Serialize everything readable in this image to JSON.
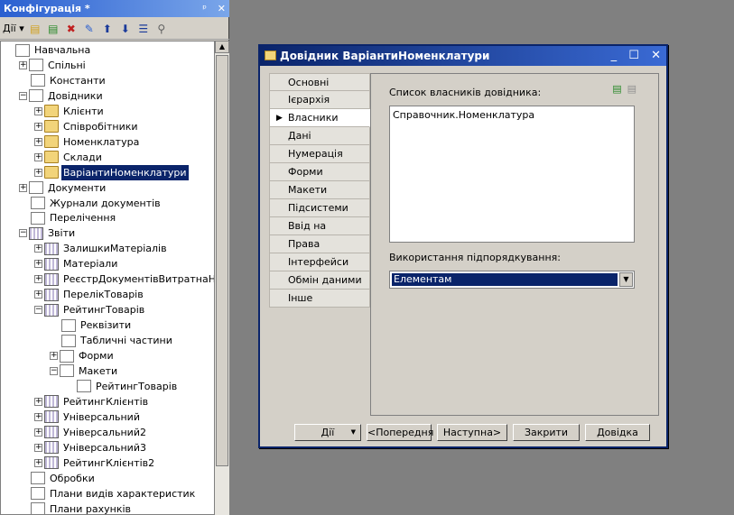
{
  "config_panel": {
    "title": "Конфігурація *",
    "pin_glyph": "ᵖ",
    "close_glyph": "✕",
    "toolbar": {
      "actions_label": "Дії",
      "icons": [
        "add-icon",
        "add-child-icon",
        "delete-icon",
        "edit-icon",
        "move-up-icon",
        "move-down-icon",
        "sort-icon",
        "filter-icon"
      ]
    },
    "tree": [
      {
        "label": "Навчальна",
        "level": 0,
        "expander": "",
        "icon": "config-icon"
      },
      {
        "label": "Спільні",
        "level": 1,
        "expander": "+",
        "icon": "common-icon"
      },
      {
        "label": "Константи",
        "level": 1,
        "expander": "",
        "icon": "constants-icon"
      },
      {
        "label": "Довідники",
        "level": 1,
        "expander": "−",
        "icon": "catalogs-icon"
      },
      {
        "label": "Клієнти",
        "level": 2,
        "expander": "+",
        "icon": "folder-icon"
      },
      {
        "label": "Співробітники",
        "level": 2,
        "expander": "+",
        "icon": "folder-icon"
      },
      {
        "label": "Номенклатура",
        "level": 2,
        "expander": "+",
        "icon": "folder-icon"
      },
      {
        "label": "Склади",
        "level": 2,
        "expander": "+",
        "icon": "folder-icon"
      },
      {
        "label": "ВаріантиНоменклатури",
        "level": 2,
        "expander": "+",
        "icon": "folder-icon",
        "selected": true
      },
      {
        "label": "Документи",
        "level": 1,
        "expander": "+",
        "icon": "documents-icon"
      },
      {
        "label": "Журнали документів",
        "level": 1,
        "expander": "",
        "icon": "journals-icon"
      },
      {
        "label": "Перелічення",
        "level": 1,
        "expander": "",
        "icon": "enums-icon"
      },
      {
        "label": "Звіти",
        "level": 1,
        "expander": "−",
        "icon": "reports-icon"
      },
      {
        "label": "ЗалишкиМатеріалів",
        "level": 2,
        "expander": "+",
        "icon": "report-icon"
      },
      {
        "label": "Матеріали",
        "level": 2,
        "expander": "+",
        "icon": "report-icon"
      },
      {
        "label": "РеєстрДокументівВитратнаНакла",
        "level": 2,
        "expander": "+",
        "icon": "report-icon"
      },
      {
        "label": "ПерелікТоварів",
        "level": 2,
        "expander": "+",
        "icon": "report-icon"
      },
      {
        "label": "РейтингТоварів",
        "level": 2,
        "expander": "−",
        "icon": "report-icon"
      },
      {
        "label": "Реквізити",
        "level": 3,
        "expander": "",
        "icon": "attributes-icon"
      },
      {
        "label": "Табличні частини",
        "level": 3,
        "expander": "",
        "icon": "table-icon"
      },
      {
        "label": "Форми",
        "level": 3,
        "expander": "+",
        "icon": "forms-icon"
      },
      {
        "label": "Макети",
        "level": 3,
        "expander": "−",
        "icon": "templates-icon"
      },
      {
        "label": "РейтингТоварів",
        "level": 4,
        "expander": "",
        "icon": "template-icon"
      },
      {
        "label": "РейтингКлієнтів",
        "level": 2,
        "expander": "+",
        "icon": "report-icon"
      },
      {
        "label": "Універсальний",
        "level": 2,
        "expander": "+",
        "icon": "report-icon"
      },
      {
        "label": "Універсальний2",
        "level": 2,
        "expander": "+",
        "icon": "report-icon"
      },
      {
        "label": "Універсальний3",
        "level": 2,
        "expander": "+",
        "icon": "report-icon"
      },
      {
        "label": "РейтингКлієнтів2",
        "level": 2,
        "expander": "+",
        "icon": "report-icon"
      },
      {
        "label": "Обробки",
        "level": 1,
        "expander": "",
        "icon": "processing-icon"
      },
      {
        "label": "Плани видів характеристик",
        "level": 1,
        "expander": "",
        "icon": "char-plans-icon"
      },
      {
        "label": "Плани рахунків",
        "level": 1,
        "expander": "",
        "icon": "accounts-icon"
      }
    ]
  },
  "dialog": {
    "title": "Довідник ВаріантиНоменклатури",
    "controls": [
      "_",
      "☐",
      "✕"
    ],
    "tabs": [
      "Основні",
      "Ієрархія",
      "Власники",
      "Дані",
      "Нумерація",
      "Форми",
      "Макети",
      "Підсистеми",
      "Ввід на підставі",
      "Права",
      "Інтерфейси",
      "Обмін даними",
      "Інше"
    ],
    "active_tab": "Власники",
    "owners_label": "Список власників довідника:",
    "owners_list": [
      "Справочник.Номенклатура"
    ],
    "subordination_label": "Використання підпорядкування:",
    "subordination_value": "Елементам",
    "buttons": {
      "actions": "Дії",
      "prev": "<Попередня",
      "next": "Наступна>",
      "close": "Закрити",
      "help": "Довідка"
    }
  }
}
